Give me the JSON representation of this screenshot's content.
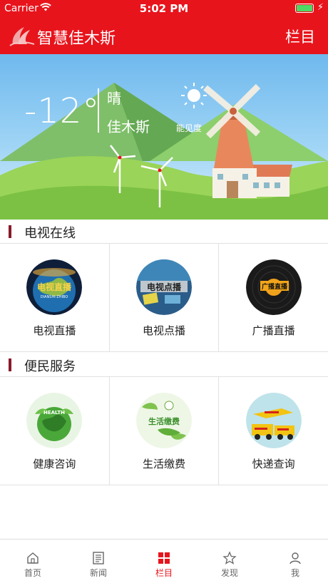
{
  "status_bar": {
    "carrier": "Carrier",
    "time": "5:02 PM"
  },
  "navbar": {
    "title": "智慧佳木斯",
    "menu_label": "栏目"
  },
  "weather": {
    "temperature": "-12°",
    "condition": "晴",
    "city": "佳木斯",
    "visibility_label": "能见度"
  },
  "sections": [
    {
      "title": "电视在线",
      "items": [
        {
          "label": "电视直播",
          "thumb_text": "电视直播",
          "thumb_sub": "DIANSHI ZHIBO",
          "icon": "globe-tv-thumbnail"
        },
        {
          "label": "电视点播",
          "thumb_text": "电视点播",
          "icon": "tv-vod-thumbnail"
        },
        {
          "label": "广播直播",
          "thumb_text": "广播直播",
          "icon": "vinyl-record-thumbnail"
        }
      ]
    },
    {
      "title": "便民服务",
      "items": [
        {
          "label": "健康咨询",
          "thumb_text": "HEALTH",
          "icon": "health-globe-thumbnail"
        },
        {
          "label": "生活缴费",
          "thumb_text": "生活缴费",
          "icon": "bill-payment-thumbnail"
        },
        {
          "label": "快递查询",
          "icon": "express-delivery-thumbnail"
        }
      ]
    }
  ],
  "tabbar": [
    {
      "label": "首页",
      "icon": "home-icon",
      "active": false
    },
    {
      "label": "新闻",
      "icon": "news-icon",
      "active": false
    },
    {
      "label": "栏目",
      "icon": "grid-icon",
      "active": true
    },
    {
      "label": "发现",
      "icon": "discover-icon",
      "active": false
    },
    {
      "label": "我",
      "icon": "user-icon",
      "active": false
    }
  ],
  "colors": {
    "brand_red": "#e8141c",
    "section_bar": "#8a1a2a",
    "battery_green": "#4cd964"
  }
}
